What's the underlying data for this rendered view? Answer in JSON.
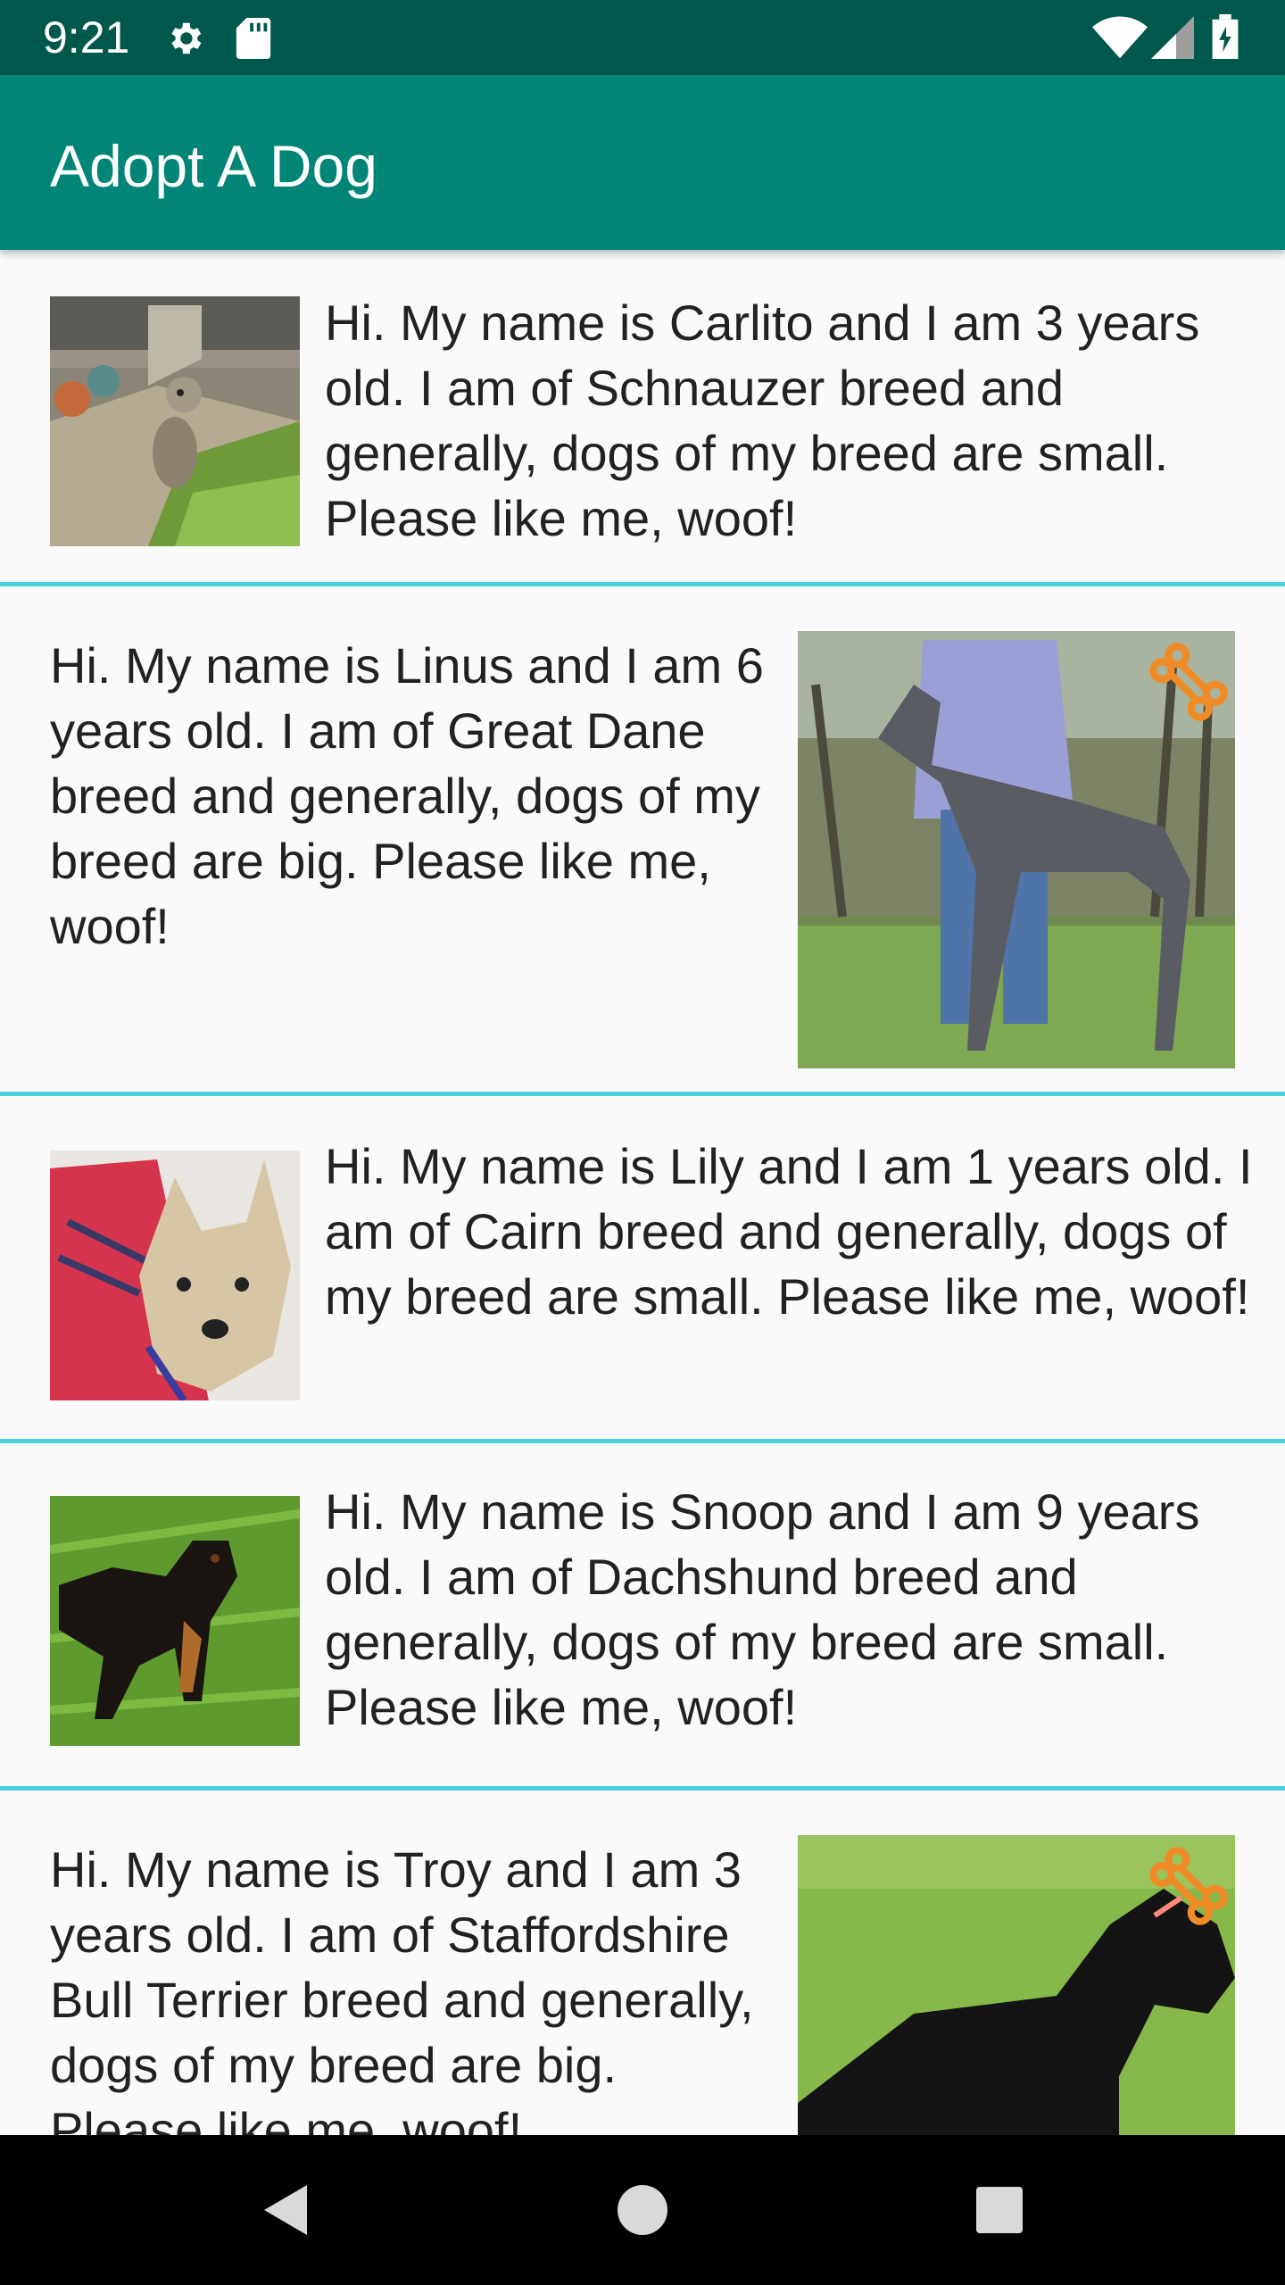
{
  "status_bar": {
    "time": "9:21",
    "icons": [
      "gear-icon",
      "sd-card-icon",
      "wifi-icon",
      "signal-icon",
      "battery-icon"
    ]
  },
  "app_bar": {
    "title": "Adopt A Dog"
  },
  "colors": {
    "app_bar": "#008577",
    "status_bar": "#00574b",
    "divider": "#4dd0e1",
    "bone_badge": "#f08c28"
  },
  "dogs": [
    {
      "text": "Hi. My name is Carlito and I am 3 years old. I am of Schnauzer breed and generally, dogs of my breed are small. Please like me, woof!",
      "liked": false
    },
    {
      "text": "Hi. My name is Linus and I am 6 years old. I am of Great Dane breed and generally, dogs of my breed are big. Please like me, woof!",
      "liked": true
    },
    {
      "text": "Hi. My name is Lily and I am 1 years old. I am of Cairn breed and generally, dogs of my breed are small. Please like me, woof!",
      "liked": false
    },
    {
      "text": "Hi. My name is Snoop and I am 9 years old. I am of Dachshund breed and generally, dogs of my breed are small. Please like me, woof!",
      "liked": false
    },
    {
      "text": "Hi. My name is Troy and I am 3 years old. I am of Staffordshire Bull Terrier breed and generally, dogs of my breed are big. Please like me, woof!",
      "liked": true
    }
  ],
  "nav_bar": {
    "buttons": [
      "back-icon",
      "home-icon",
      "recents-icon"
    ]
  }
}
